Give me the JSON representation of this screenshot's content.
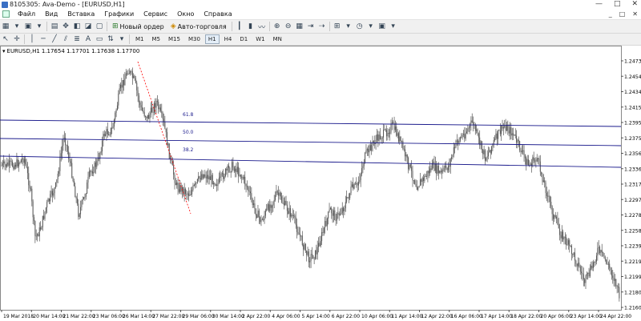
{
  "window": {
    "title": "8105305: Ava-Demo - [EURUSD,H1]",
    "controls": [
      "—",
      "□",
      "✕"
    ]
  },
  "menu": {
    "items": [
      "Файл",
      "Вид",
      "Вставка",
      "Графики",
      "Сервис",
      "Окно",
      "Справка"
    ],
    "mdi_controls": [
      "_",
      "□",
      "✕"
    ]
  },
  "toolbar": {
    "new_order_label": "Новый ордер",
    "auto_trading_label": "Авто-торговля"
  },
  "timeframes": {
    "items": [
      "M1",
      "M5",
      "M15",
      "M30",
      "H1",
      "H4",
      "D1",
      "W1",
      "MN"
    ],
    "active": "H1"
  },
  "chart": {
    "symbol_label": "EURUSD,H1",
    "ohlc_label": "1.17654 1.17701 1.17638 1.17700",
    "price_ticks": [
      "1.24735",
      "1.24540",
      "1.24345",
      "1.24150",
      "1.23950",
      "1.23755",
      "1.23560",
      "1.23365",
      "1.23170",
      "1.22975",
      "1.22780",
      "1.22585",
      "1.22390",
      "1.22190",
      "1.21995",
      "1.21800",
      "1.21605"
    ],
    "time_ticks": [
      "19 Mar 2018",
      "20 Mar 14:00",
      "21 Mar 22:00",
      "23 Mar 06:00",
      "26 Mar 14:00",
      "27 Mar 22:00",
      "29 Mar 06:00",
      "30 Mar 14:00",
      "2 Apr 22:00",
      "4 Apr 06:00",
      "5 Apr 14:00",
      "6 Apr 22:00",
      "10 Apr 06:00",
      "11 Apr 14:00",
      "12 Apr 22:00",
      "16 Apr 06:00",
      "17 Apr 14:00",
      "18 Apr 22:00",
      "20 Apr 06:00",
      "23 Apr 14:00",
      "24 Apr 22:00"
    ],
    "fib_levels": [
      "61.8",
      "50.0",
      "38.2"
    ],
    "colors": {
      "candles": "#555555",
      "fib_lines": "#1a1a8c",
      "trend_line": "#ff0000",
      "grid_text": "#000000"
    }
  }
}
